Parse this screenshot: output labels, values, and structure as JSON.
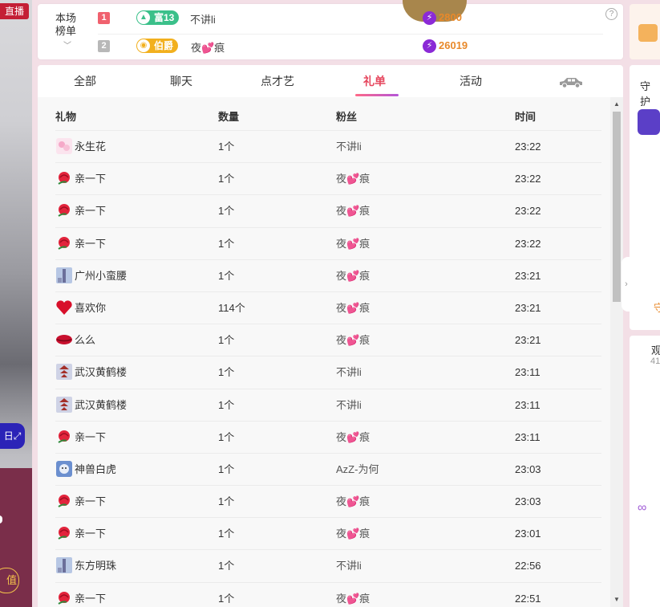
{
  "left": {
    "live_badge": "直播",
    "zoom_chip": "日⤢",
    "recharge_chip": "值"
  },
  "rank": {
    "title_line1": "本场",
    "title_line2": "榜单",
    "rows": [
      {
        "rank": "1",
        "rank_color": "#f0616e",
        "badge": "富13",
        "badge_color": "#3bc08a",
        "badge_icon": "▲",
        "name": "不讲li",
        "score": "2800"
      },
      {
        "rank": "2",
        "rank_color": "#b8b8b8",
        "badge": "伯爵",
        "badge_color": "#f2b01e",
        "badge_icon": "◉",
        "name": "夜💕痕",
        "score": "26019"
      }
    ]
  },
  "tabs": [
    {
      "label": "全部",
      "active": false
    },
    {
      "label": "聊天",
      "active": false
    },
    {
      "label": "点才艺",
      "active": false
    },
    {
      "label": "礼单",
      "active": true
    },
    {
      "label": "活动",
      "active": false
    }
  ],
  "table": {
    "headers": {
      "gift": "礼物",
      "qty": "数量",
      "fan": "粉丝",
      "time": "时间"
    },
    "rows": [
      {
        "icon": "flower",
        "gift": "永生花",
        "qty": "1个",
        "fan": "不讲li",
        "time": "23:22"
      },
      {
        "icon": "rose",
        "gift": "亲一下",
        "qty": "1个",
        "fan": "夜💕痕",
        "time": "23:22"
      },
      {
        "icon": "rose",
        "gift": "亲一下",
        "qty": "1个",
        "fan": "夜💕痕",
        "time": "23:22"
      },
      {
        "icon": "rose",
        "gift": "亲一下",
        "qty": "1个",
        "fan": "夜💕痕",
        "time": "23:22"
      },
      {
        "icon": "tower",
        "gift": "广州小蛮腰",
        "qty": "1个",
        "fan": "夜💕痕",
        "time": "23:21"
      },
      {
        "icon": "heart",
        "gift": "喜欢你",
        "qty": "114个",
        "fan": "夜💕痕",
        "time": "23:21"
      },
      {
        "icon": "lips",
        "gift": "么么",
        "qty": "1个",
        "fan": "夜💕痕",
        "time": "23:21"
      },
      {
        "icon": "pagoda",
        "gift": "武汉黄鹤楼",
        "qty": "1个",
        "fan": "不讲li",
        "time": "23:11"
      },
      {
        "icon": "pagoda",
        "gift": "武汉黄鹤楼",
        "qty": "1个",
        "fan": "不讲li",
        "time": "23:11"
      },
      {
        "icon": "rose",
        "gift": "亲一下",
        "qty": "1个",
        "fan": "夜💕痕",
        "time": "23:11"
      },
      {
        "icon": "tiger",
        "gift": "神兽白虎",
        "qty": "1个",
        "fan": "AzZ-为何",
        "time": "23:03"
      },
      {
        "icon": "rose",
        "gift": "亲一下",
        "qty": "1个",
        "fan": "夜💕痕",
        "time": "23:03"
      },
      {
        "icon": "rose",
        "gift": "亲一下",
        "qty": "1个",
        "fan": "夜💕痕",
        "time": "23:01"
      },
      {
        "icon": "tower",
        "gift": "东方明珠",
        "qty": "1个",
        "fan": "不讲li",
        "time": "22:56"
      },
      {
        "icon": "rose",
        "gift": "亲一下",
        "qty": "1个",
        "fan": "夜💕痕",
        "time": "22:51"
      }
    ]
  },
  "right": {
    "guard_label": "守护",
    "guard_foot": "守",
    "view_label": "观",
    "view_count": "41"
  }
}
